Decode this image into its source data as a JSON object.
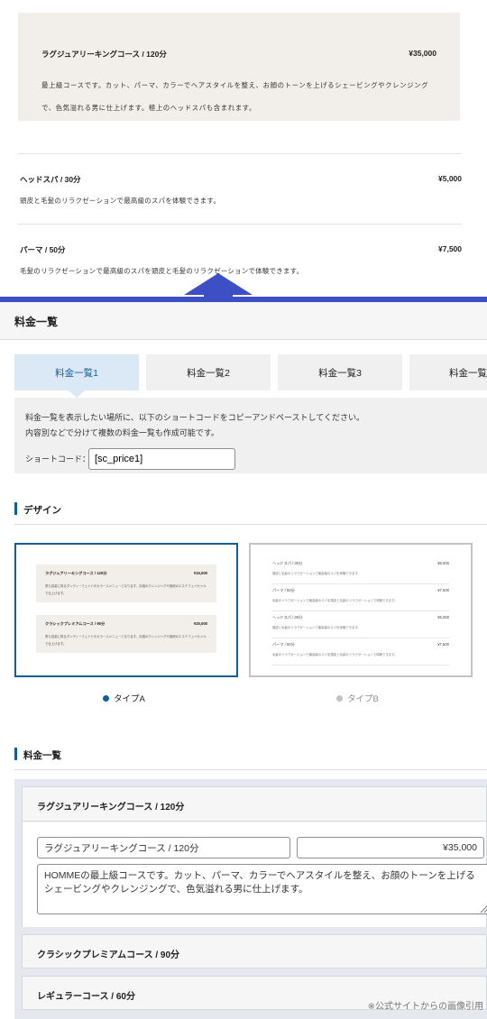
{
  "preview": {
    "featured": {
      "name": "ラグジュアリーキングコース / 120分",
      "price": "¥35,000",
      "desc": "最上級コースです。カット、パーマ、カラーでヘアスタイルを整え、お顔のトーンを上げるシェービングやクレンジングで、色気溢れる男に仕上げます。極上のヘッドスパも含まれます。"
    },
    "items": [
      {
        "name": "ヘッドスパ / 30分",
        "price": "¥5,000",
        "desc": "頭皮と毛髪のリラクゼーションで最高級のスパを体験できます。"
      },
      {
        "name": "パーマ / 50分",
        "price": "¥7,500",
        "desc": "毛髪のリラクゼーションで最高級のスパを頭皮と毛髪のリラクゼーションで体験できます。"
      }
    ]
  },
  "admin": {
    "title": "料金一覧",
    "tabs": [
      "料金一覧1",
      "料金一覧2",
      "料金一覧3",
      "料金一覧"
    ],
    "panel": {
      "desc_line1": "料金一覧を表示したい場所に、以下のショートコードをコピーアンドペーストしてください。",
      "desc_line2": "内容別などで分けて複数の料金一覧も作成可能です。",
      "shortcode_label": "ショートコード：",
      "shortcode_value": "[sc_price1]"
    },
    "design_title": "デザイン",
    "design": {
      "type_a_label": "タイプA",
      "type_b_label": "タイプB",
      "type_a_preview": [
        {
          "name": "ラグジュアリーキングコース / 120分",
          "price": "¥15,000",
          "desc": "男も容姿に拘るダンディーフェイドのカラースメニューとなります。お顔のクレンジングや施術のエステフェイセャルで仕上げます。"
        },
        {
          "name": "クラシックプレミアムコース / 90分",
          "price": "¥25,000",
          "desc": "男も容姿に拘るダンディーフェイドのカラースメニューとなります。お顔のクレンジングや施術のエステフェイセャルで仕上げます。"
        }
      ],
      "type_b_preview": [
        {
          "name": "ヘッドスパ / 30分",
          "price": "¥5,000",
          "desc": "頭皮と毛髪のリラクゼーションで最高級のスパを体験できます。"
        },
        {
          "name": "パーマ / 50分",
          "price": "¥7,500",
          "desc": "毛髪のリラクゼーションで最高級のスパを頭皮と毛髪のリラクゼーションで体験できます。"
        },
        {
          "name": "ヘッドスパ / 30分",
          "price": "¥5,000",
          "desc": "頭皮と毛髪のリラクゼーションで最高級のスパを体験できます。"
        },
        {
          "name": "パーマ / 50分",
          "price": "¥7,500",
          "desc": "毛髪のリラクゼーションで最高級のスパを頭皮と毛髪のリラクゼーションで体験できます。"
        }
      ]
    },
    "list_title": "料金一覧",
    "courses": [
      {
        "name": "ラグジュアリーキングコース / 120分",
        "field_name": "ラグジュアリーキングコース / 120分",
        "field_price": "¥35,000",
        "field_desc": "HOMMEの最上級コースです。カット、パーマ、カラーでヘアスタイルを整え、お顔のトーンを上げるシェービングやクレンジングで、色気溢れる男に仕上げます。"
      },
      {
        "name": "クラシックプレミアムコース / 90分"
      },
      {
        "name": "レギュラーコース / 60分"
      }
    ],
    "credit": "※公式サイトからの画像引用"
  },
  "colors": {
    "accent": "#135e96",
    "divider": "#3d4fc4",
    "featured_bg": "#f2efea"
  }
}
